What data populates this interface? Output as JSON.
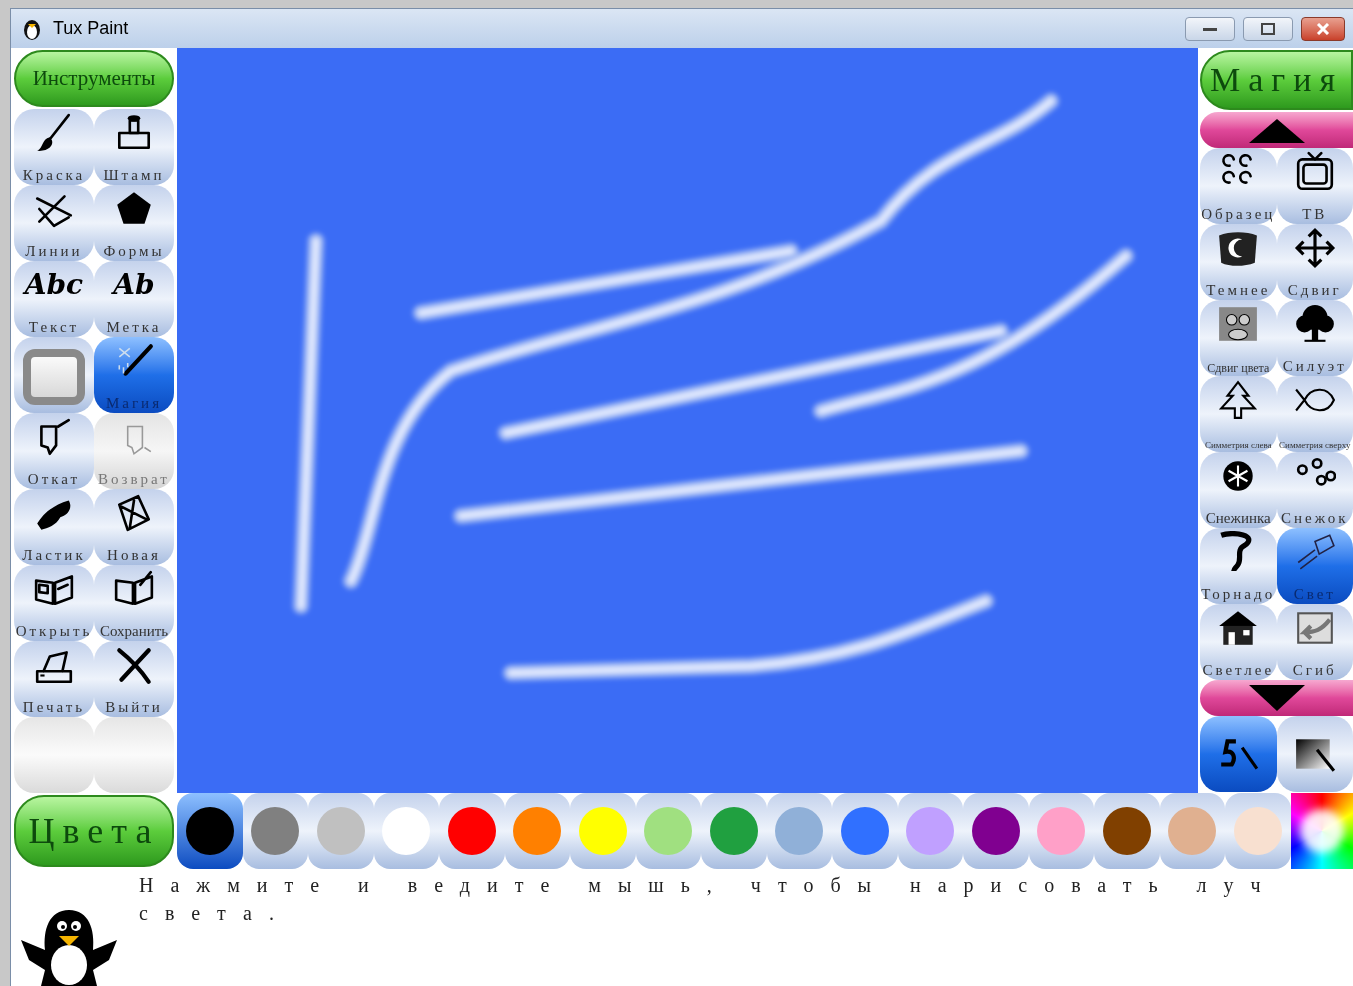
{
  "window": {
    "title": "Tux Paint"
  },
  "tools_header": "Инструменты",
  "tools": [
    {
      "label": "Краска",
      "selected": false,
      "disabled": false
    },
    {
      "label": "Штамп",
      "selected": false,
      "disabled": false
    },
    {
      "label": "Линии",
      "selected": false,
      "disabled": false
    },
    {
      "label": "Формы",
      "selected": false,
      "disabled": false
    },
    {
      "label": "Текст",
      "glyph": "Abc",
      "selected": false,
      "disabled": false
    },
    {
      "label": "Метка",
      "glyph": "Ab",
      "selected": false,
      "disabled": false
    },
    {
      "selected": false,
      "disabled": false
    },
    {
      "label": "Магия",
      "selected": true,
      "disabled": false
    },
    {
      "label": "Откат",
      "selected": false,
      "disabled": false
    },
    {
      "label": "Возврат",
      "selected": false,
      "disabled": true
    },
    {
      "label": "Ластик",
      "selected": false,
      "disabled": false
    },
    {
      "label": "Новая",
      "selected": false,
      "disabled": false
    },
    {
      "label": "Открыть",
      "selected": false,
      "disabled": false
    },
    {
      "label": "Сохранить",
      "selected": false,
      "disabled": false
    },
    {
      "label": "Печать",
      "selected": false,
      "disabled": false
    },
    {
      "label": "Выйти",
      "selected": false,
      "disabled": false
    }
  ],
  "magic_header": "Магия",
  "magic": [
    {
      "label": "Образец",
      "selected": false
    },
    {
      "label": "ТВ",
      "selected": false
    },
    {
      "label": "Темнее",
      "selected": false
    },
    {
      "label": "Сдвиг",
      "selected": false
    },
    {
      "label": "Сдвиг цвета",
      "selected": false
    },
    {
      "label": "Силуэт",
      "selected": false
    },
    {
      "label": "Симметрия слева",
      "selected": false
    },
    {
      "label": "Симметрия сверху",
      "selected": false
    },
    {
      "label": "Снежинка",
      "selected": false
    },
    {
      "label": "Снежок",
      "selected": false
    },
    {
      "label": "Торнадо",
      "selected": false
    },
    {
      "label": "Свет",
      "selected": true
    },
    {
      "label": "Светлее",
      "selected": false
    },
    {
      "label": "Сгиб",
      "selected": false
    }
  ],
  "magic_modes": [
    {
      "selected": true
    },
    {
      "selected": false
    }
  ],
  "colors_header": "Цвета",
  "colors": [
    {
      "color": "#000000",
      "selected": true
    },
    {
      "color": "#808080",
      "selected": false
    },
    {
      "color": "#c0c0c0",
      "selected": false
    },
    {
      "color": "#ffffff",
      "selected": false
    },
    {
      "color": "#ff0000",
      "selected": false
    },
    {
      "color": "#ff8000",
      "selected": false
    },
    {
      "color": "#ffff00",
      "selected": false
    },
    {
      "color": "#a0e080",
      "selected": false
    },
    {
      "color": "#20a040",
      "selected": false
    },
    {
      "color": "#90b0d8",
      "selected": false
    },
    {
      "color": "#3070ff",
      "selected": false
    },
    {
      "color": "#c0a0ff",
      "selected": false
    },
    {
      "color": "#800090",
      "selected": false
    },
    {
      "color": "#ffa0c8",
      "selected": false
    },
    {
      "color": "#804000",
      "selected": false
    },
    {
      "color": "#e0b090",
      "selected": false
    },
    {
      "color": "#f8e0d0",
      "selected": false
    }
  ],
  "status_text": "Нажмите и ведите мышь, чтобы нарисовать луч света."
}
